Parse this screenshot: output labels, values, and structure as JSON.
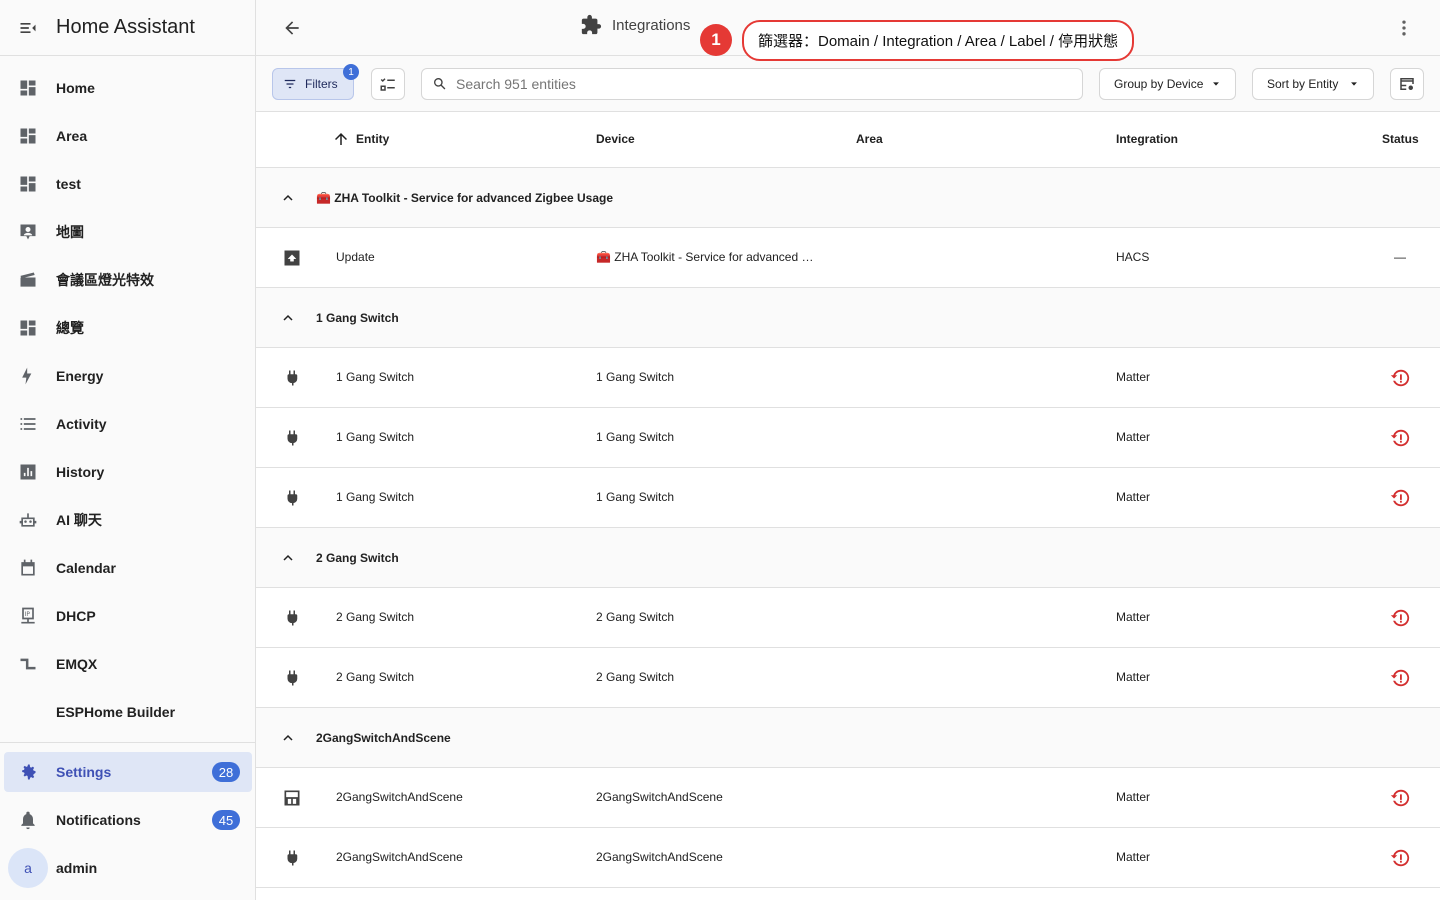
{
  "app": {
    "title": "Home Assistant"
  },
  "sidebar": {
    "items": [
      {
        "label": "Home",
        "icon": "dashboard-icon"
      },
      {
        "label": "Area",
        "icon": "dashboard-icon"
      },
      {
        "label": "test",
        "icon": "dashboard-icon"
      },
      {
        "label": "地圖",
        "icon": "map-account-icon"
      },
      {
        "label": "會議區燈光特效",
        "icon": "movie-clapper-icon"
      },
      {
        "label": "總覽",
        "icon": "dashboard-icon"
      },
      {
        "label": "Energy",
        "icon": "lightning-bolt-icon"
      },
      {
        "label": "Activity",
        "icon": "format-list-icon"
      },
      {
        "label": "History",
        "icon": "chart-box-icon"
      },
      {
        "label": "AI 聊天",
        "icon": "robot-icon"
      },
      {
        "label": "Calendar",
        "icon": "calendar-icon"
      },
      {
        "label": "DHCP",
        "icon": "ip-network-icon"
      },
      {
        "label": "EMQX",
        "icon": "pipe-icon"
      },
      {
        "label": "ESPHome Builder",
        "icon": ""
      }
    ],
    "settings": {
      "label": "Settings",
      "badge": "28"
    },
    "notifications": {
      "label": "Notifications",
      "badge": "45"
    },
    "user": {
      "label": "admin",
      "initial": "a"
    }
  },
  "topbar": {
    "title": "Integrations"
  },
  "annotation": {
    "number": "1",
    "text": "篩選器：Domain / Integration / Area / Label / 停用狀態"
  },
  "toolbar": {
    "filters_label": "Filters",
    "filters_badge": "1",
    "search_placeholder": "Search 951 entities",
    "group_by_label": "Group by Device",
    "sort_by_label": "Sort by Entity"
  },
  "table": {
    "columns": {
      "entity": "Entity",
      "device": "Device",
      "area": "Area",
      "integration": "Integration",
      "status": "Status"
    },
    "groups": [
      {
        "title": "🧰 ZHA Toolkit - Service for advanced Zigbee Usage",
        "rows": [
          {
            "icon": "package-up-icon",
            "entity": "Update",
            "device": "🧰 ZHA Toolkit - Service for advanced …",
            "area": "",
            "integration": "HACS",
            "status": "—"
          }
        ]
      },
      {
        "title": "1 Gang Switch",
        "rows": [
          {
            "icon": "power-plug-icon",
            "entity": "1 Gang Switch",
            "device": "1 Gang Switch",
            "area": "",
            "integration": "Matter",
            "status": "restore-alert-icon"
          },
          {
            "icon": "power-plug-icon",
            "entity": "1 Gang Switch",
            "device": "1 Gang Switch",
            "area": "",
            "integration": "Matter",
            "status": "restore-alert-icon"
          },
          {
            "icon": "power-plug-icon",
            "entity": "1 Gang Switch",
            "device": "1 Gang Switch",
            "area": "",
            "integration": "Matter",
            "status": "restore-alert-icon"
          }
        ]
      },
      {
        "title": "2 Gang Switch",
        "rows": [
          {
            "icon": "power-plug-icon",
            "entity": "2 Gang Switch",
            "device": "2 Gang Switch",
            "area": "",
            "integration": "Matter",
            "status": "restore-alert-icon"
          },
          {
            "icon": "power-plug-icon",
            "entity": "2 Gang Switch",
            "device": "2 Gang Switch",
            "area": "",
            "integration": "Matter",
            "status": "restore-alert-icon"
          }
        ]
      },
      {
        "title": "2GangSwitchAndScene",
        "rows": [
          {
            "icon": "palette-swatch-icon",
            "entity": "2GangSwitchAndScene",
            "device": "2GangSwitchAndScene",
            "area": "",
            "integration": "Matter",
            "status": "restore-alert-icon"
          },
          {
            "icon": "power-plug-icon",
            "entity": "2GangSwitchAndScene",
            "device": "2GangSwitchAndScene",
            "area": "",
            "integration": "Matter",
            "status": "restore-alert-icon"
          }
        ]
      }
    ]
  },
  "colors": {
    "accent": "#3f51b5",
    "badge": "#3f6fd8",
    "alert": "#e53935"
  }
}
